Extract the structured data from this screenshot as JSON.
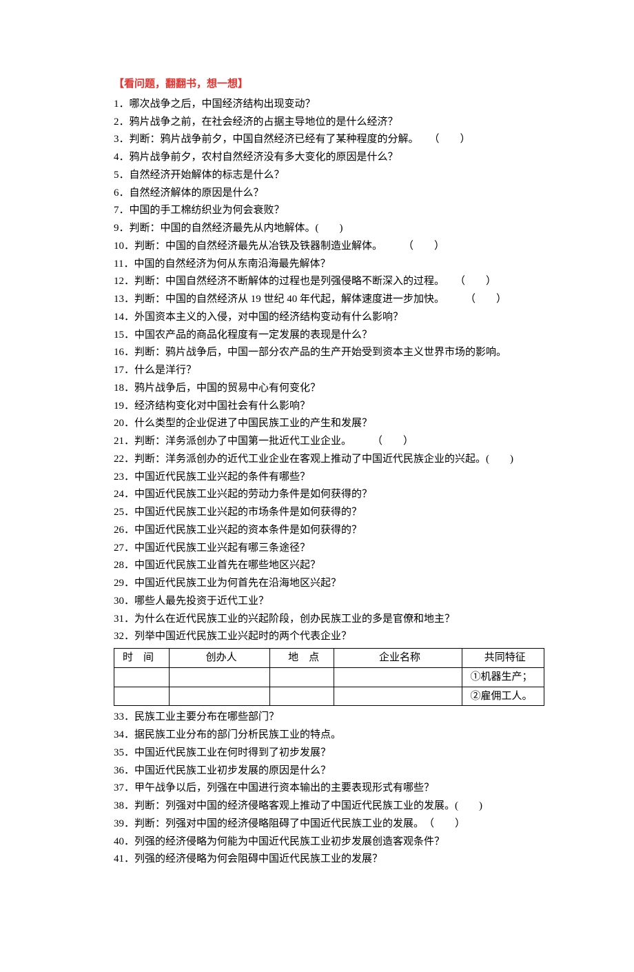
{
  "section_title": "【看问题，翻翻书，想一想】",
  "questions_part1": [
    "1．哪次战争之后，中国经济结构出现变动？",
    "2．鸦片战争之前，在社会经济的占据主导地位的是什么经济？",
    "3．判断：鸦片战争前夕，中国自然经济已经有了某种程度的分解。　　（　　）",
    "4．鸦片战争前夕，农村自然经济没有多大变化的原因是什么？",
    "5．自然经济开始解体的标志是什么？",
    "6．自然经济解体的原因是什么？",
    "7．中国的手工棉纺织业为何会衰败？",
    "9．判断：中国的自然经济最先从内地解体。(　　)",
    "10．判断：中国的自然经济最先从冶铁及铁器制造业解体。　　　（　　）",
    "11．中国的自然经济为何从东南沿海最先解体？",
    "12．判断：中国自然经济不断解体的过程也是列强侵略不断深入的过程。　　（　　）",
    "13．判断：中国的自然经济从 19 世纪 40 年代起，解体速度进一步加快。　　　（　　）",
    "14．外国资本主义的入侵，对中国的经济结构变动有什么影响？",
    "15．中国农产品的商品化程度有一定发展的表现是什么？",
    "16．判断：鸦片战争后，中国一部分农产品的生产开始受到资本主义世界市场的影响。",
    "17．什么是洋行？",
    "18．鸦片战争后，中国的贸易中心有何变化？",
    "19．经济结构变化对中国社会有什么影响？",
    "20．什么类型的企业促进了中国民族工业的产生和发展？",
    "21．判断：洋务派创办了中国第一批近代工业企业。　　　（　　）",
    "22．判断：洋务派创办的近代工业企业在客观上推动了中国近代民族企业的兴起。(　　)",
    "23．中国近代民族工业兴起的条件有哪些？",
    "24．中国近代民族工业兴起的劳动力条件是如何获得的？",
    "25．中国近代民族工业兴起的市场条件是如何获得的？",
    "26．中国近代民族工业兴起的资本条件是如何获得的？",
    "27．中国近代民族工业兴起有哪三条途径？",
    "28．中国近代民族工业首先在哪些地区兴起？",
    "29．中国近代民族工业为何首先在沿海地区兴起？",
    "30．哪些人最先投资于近代工业？",
    "31．为什么在近代民族工业的兴起阶段，创办民族工业的多是官僚和地主？",
    "32．列举中国近代民族工业兴起时的两个代表企业？"
  ],
  "table": {
    "headers": {
      "time": "时　间",
      "founder": "创办人",
      "place": "地　点",
      "name": "企业名称",
      "feature": "共同特征"
    },
    "feature_rows": [
      "①机器生产；",
      "②雇佣工人。"
    ]
  },
  "questions_part2": [
    "33．民族工业主要分布在哪些部门？",
    "34．据民族工业分布的部门分析民族工业的特点。",
    "35．中国近代民族工业在何时得到了初步发展？",
    "36．中国近代民族工业初步发展的原因是什么？",
    "37．甲午战争以后，列强在中国进行资本输出的主要表现形式有哪些？",
    "38．判断：列强对中国的经济侵略客观上推动了中国近代民族工业的发展。(　　)",
    "39．判断：列强对中国的经济侵略阻碍了中国近代民族工业的发展。　（　　）",
    "40．列强的经济侵略为何能为中国近代民族工业初步发展创造客观条件？",
    "41．列强的经济侵略为何会阻碍中国近代民族工业的发展？"
  ]
}
